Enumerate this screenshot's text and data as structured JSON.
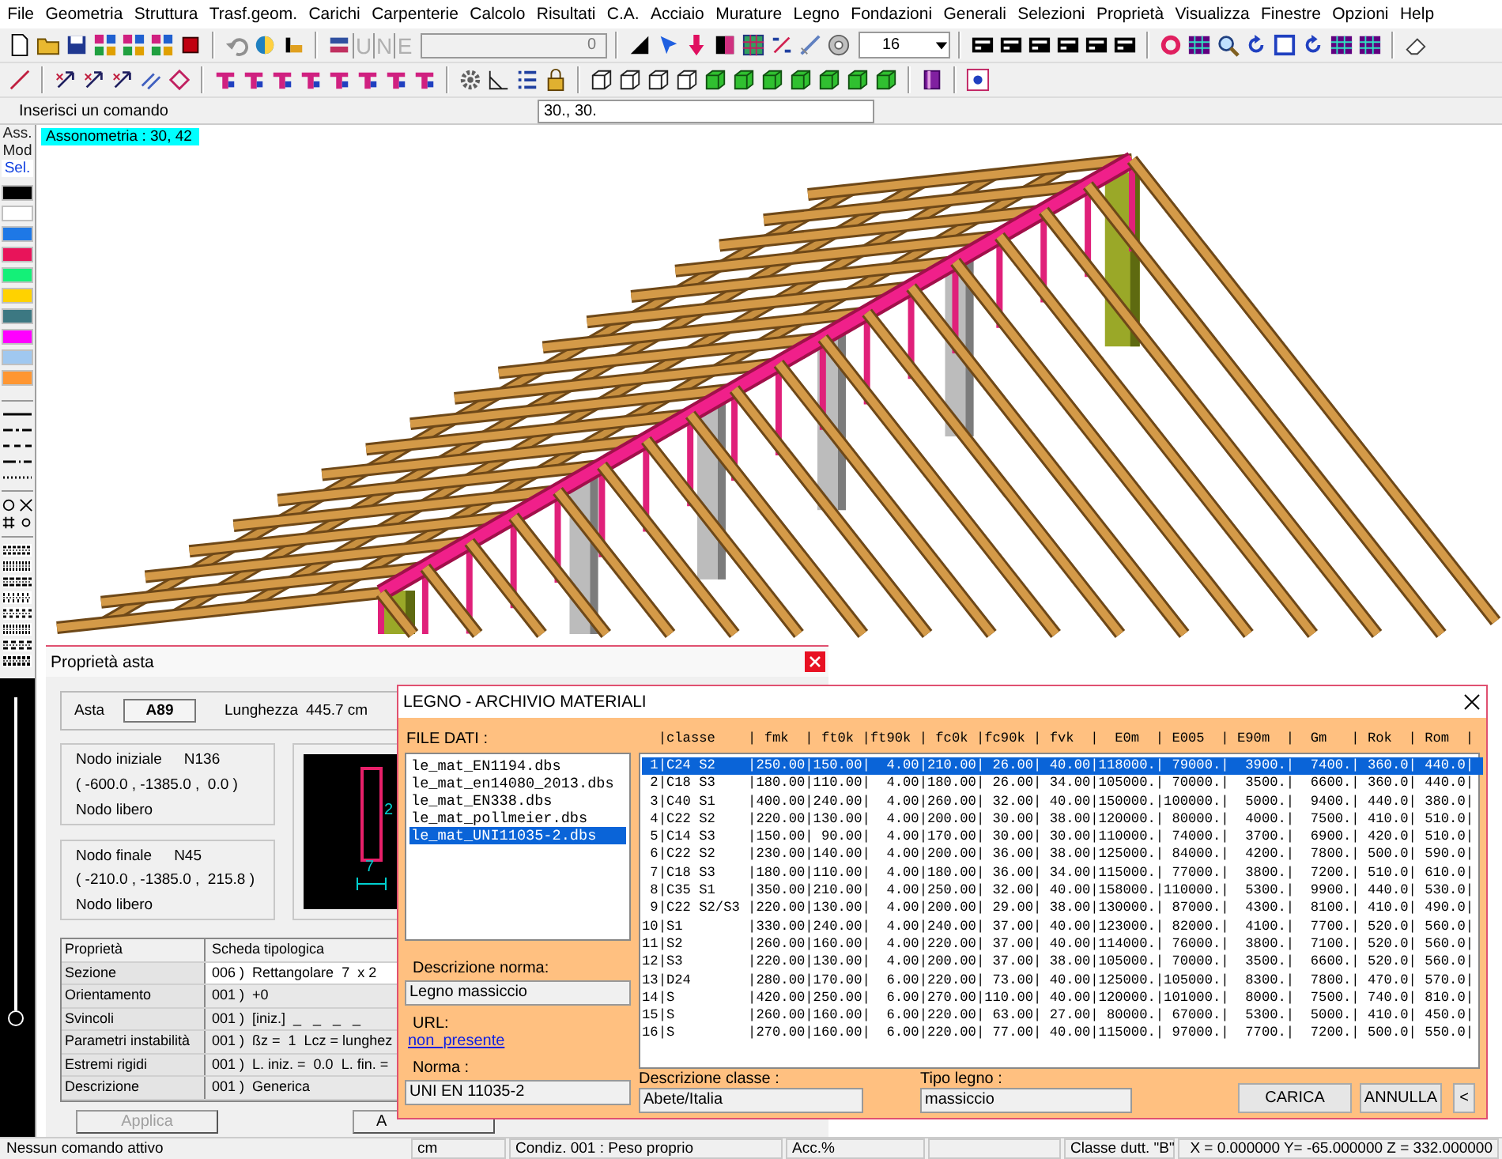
{
  "menu": [
    "File",
    "Geometria",
    "Struttura",
    "Trasf.geom.",
    "Carichi",
    "Carpenterie",
    "Calcolo",
    "Risultati",
    "C.A.",
    "Acciaio",
    "Murature",
    "Legno",
    "Fondazioni",
    "Generali",
    "Selezioni",
    "Proprietà",
    "Visualizza",
    "Finestre",
    "Opzioni",
    "Help"
  ],
  "toolbar": {
    "letter_buttons": [
      {
        "label": "U",
        "disabled": true
      },
      {
        "label": "N",
        "disabled": true
      },
      {
        "label": "E",
        "disabled": true
      }
    ],
    "counter_field": {
      "value": "0",
      "disabled": true
    },
    "size_dropdown": {
      "value": "16"
    }
  },
  "command_bar": {
    "prompt": "Inserisci un comando",
    "value": "30., 30."
  },
  "viewport": {
    "view_label": "Assonometria :  30, 42"
  },
  "palette": {
    "modes": [
      {
        "label": "Ass.",
        "selected": false
      },
      {
        "label": "Mod",
        "selected": false
      },
      {
        "label": "Sel.",
        "selected": true
      }
    ],
    "colors": [
      {
        "color": "#000000"
      },
      {
        "color": "#ffffff"
      },
      {
        "color": "#1e78e6"
      },
      {
        "color": "#e8145a"
      },
      {
        "color": "#14f078"
      },
      {
        "color": "#ffd200"
      },
      {
        "color": "#3c7882"
      },
      {
        "color": "#ff00ff"
      },
      {
        "color": "#a0c8f0"
      },
      {
        "color": "#ff9632"
      }
    ],
    "slider": {
      "level": 0.26
    }
  },
  "properties_window": {
    "title": "Proprietà asta",
    "member": {
      "label": "Asta",
      "value": "A89",
      "length_label": "Lunghezza",
      "length": "445.7 cm"
    },
    "nodes": [
      {
        "label": "Nodo iniziale",
        "id": "N136",
        "coords": "( -600.0 , -1385.0 ,  0.0 )",
        "status": "Nodo libero"
      },
      {
        "label": "Nodo finale",
        "id": "N45",
        "coords": "( -210.0 , -1385.0 ,  215.8 )",
        "status": "Nodo libero"
      }
    ],
    "section_preview": {
      "width_dim": "7",
      "height_dim": "2"
    },
    "table": {
      "columns": [
        "Proprietà",
        "Scheda tipologica"
      ],
      "rows": [
        {
          "label": "Sezione",
          "code": "006 )",
          "parts": [
            "Rettangolare",
            "7  x 2"
          ],
          "selected": true
        },
        {
          "label": "Orientamento",
          "code": "001 )",
          "parts": [
            "+0"
          ],
          "selected": false
        },
        {
          "label": "Svincoli",
          "code": "001 )",
          "parts": [
            "[iniz.]",
            "_   _   _   _"
          ],
          "selected": false
        },
        {
          "label": "Parametri instabilità",
          "code": "001 )",
          "parts": [
            "ßz =",
            "1",
            "Lcz = lunghez"
          ],
          "selected": false
        },
        {
          "label": "Estremi rigidi",
          "code": "001 )",
          "parts": [
            "L. iniz. =",
            "0.0",
            "L. fin. ="
          ],
          "selected": false
        },
        {
          "label": "Descrizione",
          "code": "001 )",
          "parts": [
            "Generica"
          ],
          "selected": false
        }
      ]
    },
    "buttons": [
      {
        "label": "Applica",
        "disabled": true
      },
      {
        "label": "A",
        "disabled": false
      }
    ]
  },
  "materials_dialog": {
    "title": "LEGNO - ARCHIVIO MATERIALI",
    "files_label": "FILE DATI :",
    "files": [
      {
        "name": "le_mat_EN1194.dbs",
        "selected": false
      },
      {
        "name": "le_mat_en14080_2013.dbs",
        "selected": false
      },
      {
        "name": "le_mat_EN338.dbs",
        "selected": false
      },
      {
        "name": "le_mat_pollmeier.dbs",
        "selected": false
      },
      {
        "name": "le_mat_UNI11035-2.dbs",
        "selected": true
      }
    ],
    "norm_description_label": "Descrizione norma:",
    "norm_description": "Legno massiccio",
    "url_label": "URL:",
    "url": "non_presente",
    "norm_label": "Norma :",
    "norm": "UNI EN 11035-2",
    "table_header": "  |classe    | fmk  | ft0k |ft90k | fc0k |fc90k | fvk  |  E0m  | E005  | E90m  |  Gm   | Rok  | Rom  |",
    "rows": [
      {
        "text": " 1|C24 S2    |250.00|150.00|  4.00|210.00| 26.00| 40.00|118000.| 79000.|  3900.|  7400.| 360.0| 440.0|",
        "selected": true
      },
      {
        "text": " 2|C18 S3    |180.00|110.00|  4.00|180.00| 26.00| 34.00|105000.| 70000.|  3500.|  6600.| 360.0| 440.0|",
        "selected": false
      },
      {
        "text": " 3|C40 S1    |400.00|240.00|  4.00|260.00| 32.00| 40.00|150000.|100000.|  5000.|  9400.| 440.0| 380.0|",
        "selected": false
      },
      {
        "text": " 4|C22 S2    |220.00|130.00|  4.00|200.00| 30.00| 38.00|120000.| 80000.|  4000.|  7500.| 410.0| 510.0|",
        "selected": false
      },
      {
        "text": " 5|C14 S3    |150.00| 90.00|  4.00|170.00| 30.00| 30.00|110000.| 74000.|  3700.|  6900.| 420.0| 510.0|",
        "selected": false
      },
      {
        "text": " 6|C22 S2    |230.00|140.00|  4.00|200.00| 36.00| 38.00|125000.| 84000.|  4200.|  7800.| 500.0| 590.0|",
        "selected": false
      },
      {
        "text": " 7|C18 S3    |180.00|110.00|  4.00|180.00| 36.00| 34.00|115000.| 77000.|  3800.|  7200.| 510.0| 610.0|",
        "selected": false
      },
      {
        "text": " 8|C35 S1    |350.00|210.00|  4.00|250.00| 32.00| 40.00|158000.|110000.|  5300.|  9900.| 440.0| 530.0|",
        "selected": false
      },
      {
        "text": " 9|C22 S2/S3 |220.00|130.00|  4.00|200.00| 29.00| 38.00|130000.| 87000.|  4300.|  8100.| 410.0| 490.0|",
        "selected": false
      },
      {
        "text": "10|S1        |330.00|240.00|  4.00|240.00| 37.00| 40.00|123000.| 82000.|  4100.|  7700.| 520.0| 560.0|",
        "selected": false
      },
      {
        "text": "11|S2        |260.00|160.00|  4.00|220.00| 37.00| 40.00|114000.| 76000.|  3800.|  7100.| 520.0| 560.0|",
        "selected": false
      },
      {
        "text": "12|S3        |220.00|130.00|  4.00|200.00| 37.00| 38.00|105000.| 70000.|  3500.|  6600.| 520.0| 560.0|",
        "selected": false
      },
      {
        "text": "13|D24       |280.00|170.00|  6.00|220.00| 73.00| 40.00|125000.|105000.|  8300.|  7800.| 470.0| 570.0|",
        "selected": false
      },
      {
        "text": "14|S         |420.00|250.00|  6.00|270.00|110.00| 40.00|120000.|101000.|  8000.|  7500.| 740.0| 810.0|",
        "selected": false
      },
      {
        "text": "15|S         |260.00|160.00|  6.00|220.00| 63.00| 27.00| 80000.| 67000.|  5300.|  5000.| 410.0| 450.0|",
        "selected": false
      },
      {
        "text": "16|S         |270.00|160.00|  6.00|220.00| 77.00| 40.00|115000.| 97000.|  7700.|  7200.| 500.0| 550.0|",
        "selected": false
      }
    ],
    "class_description_label": "Descrizione classe :",
    "class_description": "Abete/Italia",
    "wood_type_label": "Tipo legno :",
    "wood_type": "massiccio",
    "buttons": [
      "CARICA",
      "ANNULLA",
      "<"
    ]
  },
  "status_bar": [
    "Nessun comando attivo",
    "cm",
    "Condiz. 001 : Peso proprio",
    "Acc.%",
    "Classe dutt. \"B\"",
    "X = 0.000000 Y= -65.000000 Z = 332.000000"
  ]
}
